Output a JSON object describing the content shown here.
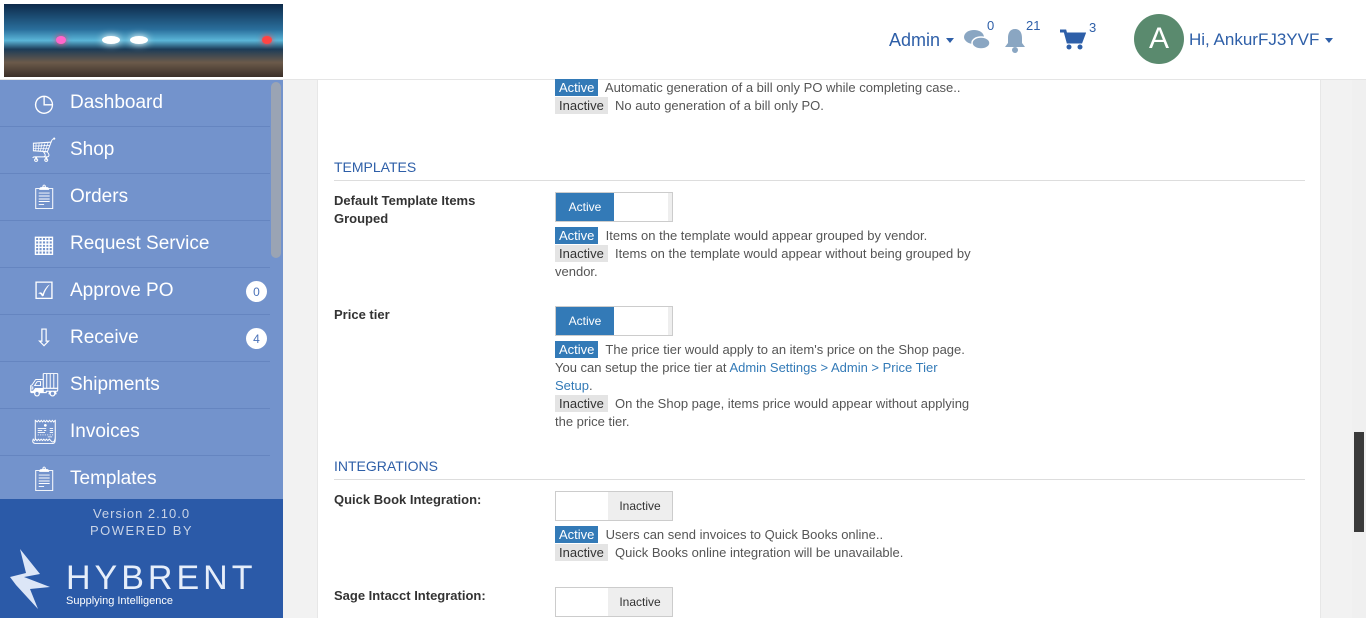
{
  "header": {
    "admin_label": "Admin",
    "messages_count": "0",
    "notifications_count": "21",
    "cart_count": "3",
    "avatar_letter": "A",
    "user_greeting": "Hi, AnkurFJ3YVF"
  },
  "sidebar": {
    "items": [
      {
        "label": "Dashboard",
        "icon": "dashboard-icon"
      },
      {
        "label": "Shop",
        "icon": "cart-icon"
      },
      {
        "label": "Orders",
        "icon": "orders-icon"
      },
      {
        "label": "Request Service",
        "icon": "request-service-icon"
      },
      {
        "label": "Approve PO",
        "icon": "approve-po-icon",
        "badge": "0"
      },
      {
        "label": "Receive",
        "icon": "receive-icon",
        "badge": "4"
      },
      {
        "label": "Shipments",
        "icon": "truck-icon"
      },
      {
        "label": "Invoices",
        "icon": "invoice-icon"
      },
      {
        "label": "Templates",
        "icon": "templates-icon"
      }
    ],
    "version": "Version 2.10.0",
    "powered_by": "POWERED BY",
    "brand": "HYBRENT",
    "tagline": "Supplying Intelligence"
  },
  "content": {
    "top": {
      "active_badge": "Active",
      "active_text": "Automatic generation of a bill only PO while completing case..",
      "inactive_badge": "Inactive",
      "inactive_text": "No auto generation of a bill only PO."
    },
    "templates_heading": "TEMPLATES",
    "default_template": {
      "label": "Default Template Items Grouped",
      "toggle": "Active",
      "active_badge": "Active",
      "active_text": "Items on the template would appear grouped by vendor.",
      "inactive_badge": "Inactive",
      "inactive_text": "Items on the template would appear without being grouped by vendor."
    },
    "price_tier": {
      "label": "Price tier",
      "toggle": "Active",
      "active_badge": "Active",
      "active_text": "The price tier would apply to an item's price on the Shop page. You can setup the price tier at",
      "link": "Admin Settings > Admin > Price Tier Setup",
      "link_after": ".",
      "inactive_badge": "Inactive",
      "inactive_text": "On the Shop page, items price would appear without applying the price tier."
    },
    "integrations_heading": "INTEGRATIONS",
    "quickbook": {
      "label": "Quick Book Integration:",
      "toggle": "Inactive",
      "active_badge": "Active",
      "active_text": "Users can send invoices to Quick Books online..",
      "inactive_badge": "Inactive",
      "inactive_text": "Quick Books online integration will be unavailable."
    },
    "sage": {
      "label": "Sage Intacct Integration:",
      "toggle": "Inactive"
    }
  }
}
